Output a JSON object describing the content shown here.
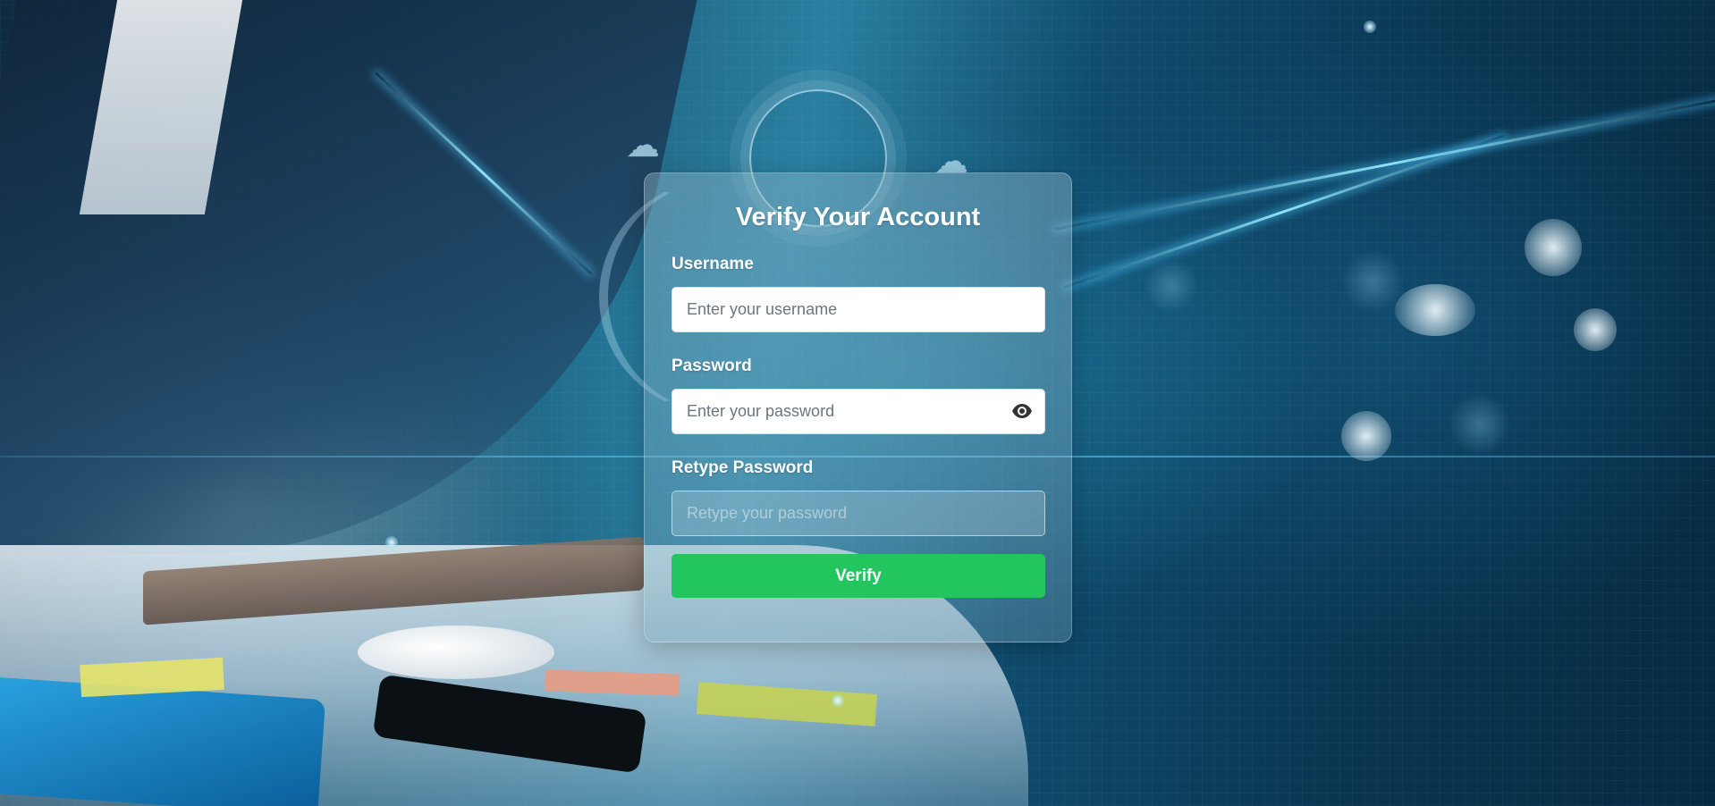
{
  "form": {
    "title": "Verify Your Account",
    "username": {
      "label": "Username",
      "placeholder": "Enter your username",
      "value": ""
    },
    "password": {
      "label": "Password",
      "placeholder": "Enter your password",
      "value": "",
      "toggle_icon": "eye-icon"
    },
    "retype_password": {
      "label": "Retype Password",
      "placeholder": "Retype your password",
      "value": "",
      "state": "disabled"
    },
    "submit_label": "Verify"
  },
  "colors": {
    "accent_button": "#22c55e",
    "card_text": "#ffffff"
  }
}
